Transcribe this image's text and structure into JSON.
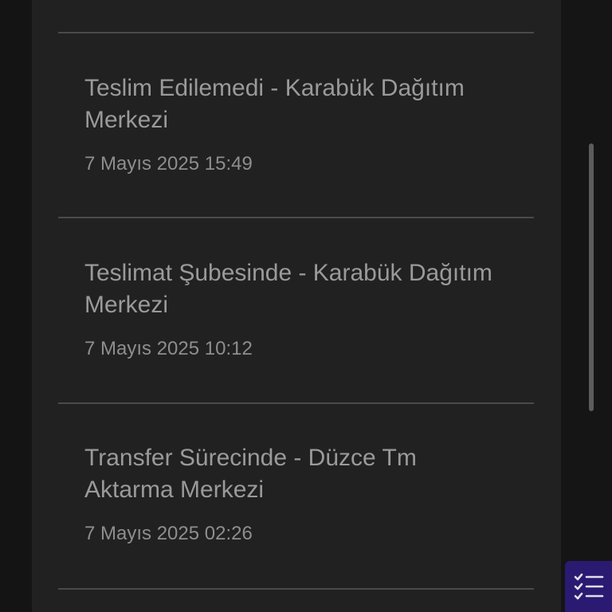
{
  "tracking_events": [
    {
      "title": "Teslim Edilemedi - Karabük Dağıtım Merkezi",
      "date": "7 Mayıs 2025 15:49"
    },
    {
      "title": "Teslimat Şubesinde - Karabük Dağıtım Merkezi",
      "date": "7 Mayıs 2025 10:12"
    },
    {
      "title": "Transfer Sürecinde - Düzce Tm Aktarma Merkezi",
      "date": "7 Mayıs 2025 02:26"
    }
  ],
  "fab": {
    "icon": "checklist-icon",
    "color": "#2a1a72"
  },
  "colors": {
    "panel": "#212121",
    "background": "#141414",
    "divider": "#4a4a4a",
    "text": "#9a9a9a"
  }
}
